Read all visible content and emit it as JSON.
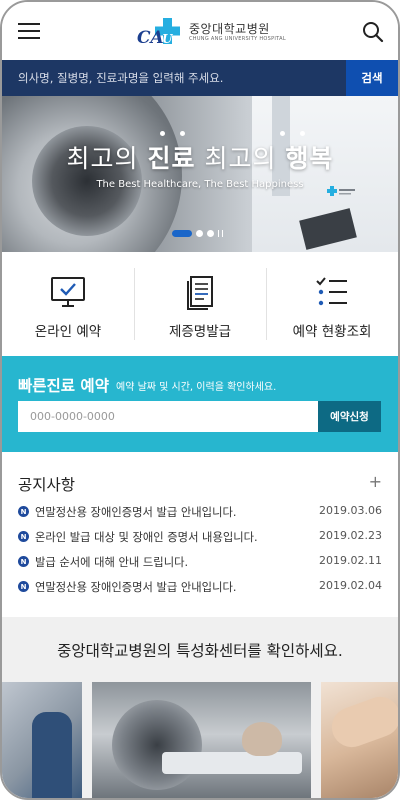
{
  "header": {
    "logo_mark": "CAU",
    "logo_name": "중앙대학교병원",
    "logo_name_en": "CHUNG ANG UNIVERSITY HOSPITAL",
    "menu_icon": "hamburger-menu-icon",
    "search_icon": "search-icon"
  },
  "search": {
    "placeholder": "의사명, 질병명, 진료과명을 입력해 주세요.",
    "button_label": "검색"
  },
  "hero": {
    "title_part1": "최고의 ",
    "title_bold1": "진료",
    "title_part2": " 최고의 ",
    "title_bold2": "행복",
    "subtitle": "The Best Healthcare, The Best Happiness",
    "slide_active": 1,
    "slide_total": 3
  },
  "quick_menu": [
    {
      "label": "온라인 예약",
      "icon": "monitor-check-icon"
    },
    {
      "label": "제증명발급",
      "icon": "document-icon"
    },
    {
      "label": "예약 현황조회",
      "icon": "checklist-icon"
    }
  ],
  "quick_appointment": {
    "title": "빠른진료 예약",
    "description": "예약 날짜 및 시간, 이력을 확인하세요.",
    "placeholder": "000-0000-0000",
    "button_label": "예약신청"
  },
  "notices": {
    "title": "공지사항",
    "more_label": "+",
    "badge": "N",
    "items": [
      {
        "text": "연말정산용 장애인증명서 발급 안내입니다.",
        "date": "2019.03.06"
      },
      {
        "text": "온라인 발급 대상 및 장애인 증명서 내용입니다.",
        "date": "2019.02.23"
      },
      {
        "text": "발급 순서에 대해 안내 드립니다.",
        "date": "2019.02.11"
      },
      {
        "text": "연말정산용 장애인증명서 발급 안내입니다.",
        "date": "2019.02.04"
      }
    ]
  },
  "centers": {
    "title": "중앙대학교병원의 특성화센터를 확인하세요."
  },
  "colors": {
    "navy": "#1d3764",
    "search_button": "#0f4fb0",
    "teal": "#27b6cf",
    "teal_dark": "#0d6a84",
    "badge": "#1f4a9c"
  }
}
